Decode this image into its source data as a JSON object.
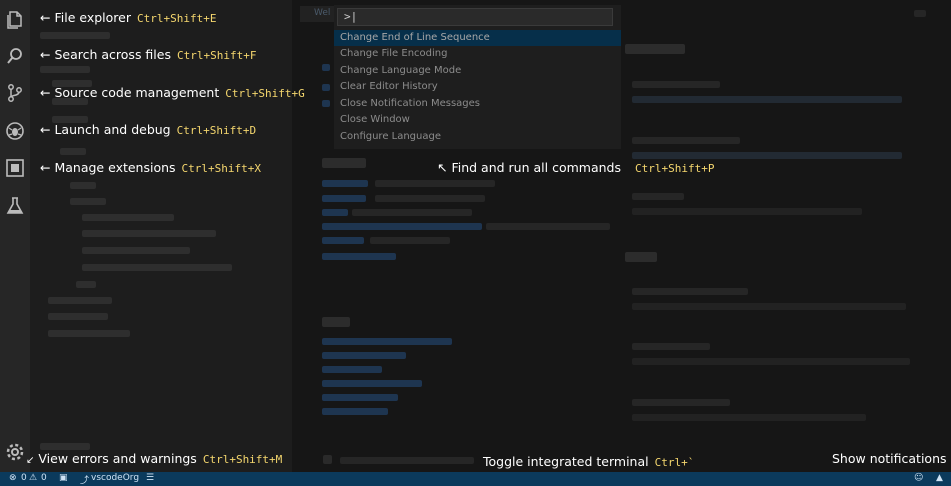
{
  "editor": {
    "tab_label": "Wel"
  },
  "palette": {
    "input_value": ">|",
    "items": [
      "Change End of Line Sequence",
      "Change File Encoding",
      "Change Language Mode",
      "Clear Editor History",
      "Close Notification Messages",
      "Close Window",
      "Configure Language"
    ],
    "selected_index": 0
  },
  "hints": {
    "explorer": {
      "label": "File explorer",
      "shortcut": "Ctrl+Shift+E"
    },
    "search": {
      "label": "Search across files",
      "shortcut": "Ctrl+Shift+F"
    },
    "scm": {
      "label": "Source code management",
      "shortcut": "Ctrl+Shift+G"
    },
    "debug": {
      "label": "Launch and debug",
      "shortcut": "Ctrl+Shift+D"
    },
    "extensions": {
      "label": "Manage extensions",
      "shortcut": "Ctrl+Shift+X"
    },
    "commands": {
      "label": "Find and run all commands",
      "shortcut": "Ctrl+Shift+P"
    },
    "problems": {
      "label": "View errors and warnings",
      "shortcut": "Ctrl+Shift+M"
    },
    "terminal": {
      "label": "Toggle integrated terminal",
      "shortcut": "Ctrl+`"
    },
    "notifications": {
      "label": "Show notifications"
    }
  },
  "status": {
    "errors": "0",
    "warnings": "0",
    "branch": "vscodeOrg"
  },
  "colors": {
    "accent": "#f5d76e",
    "status_bar": "#0b3a5c",
    "selection": "#062f4a"
  }
}
